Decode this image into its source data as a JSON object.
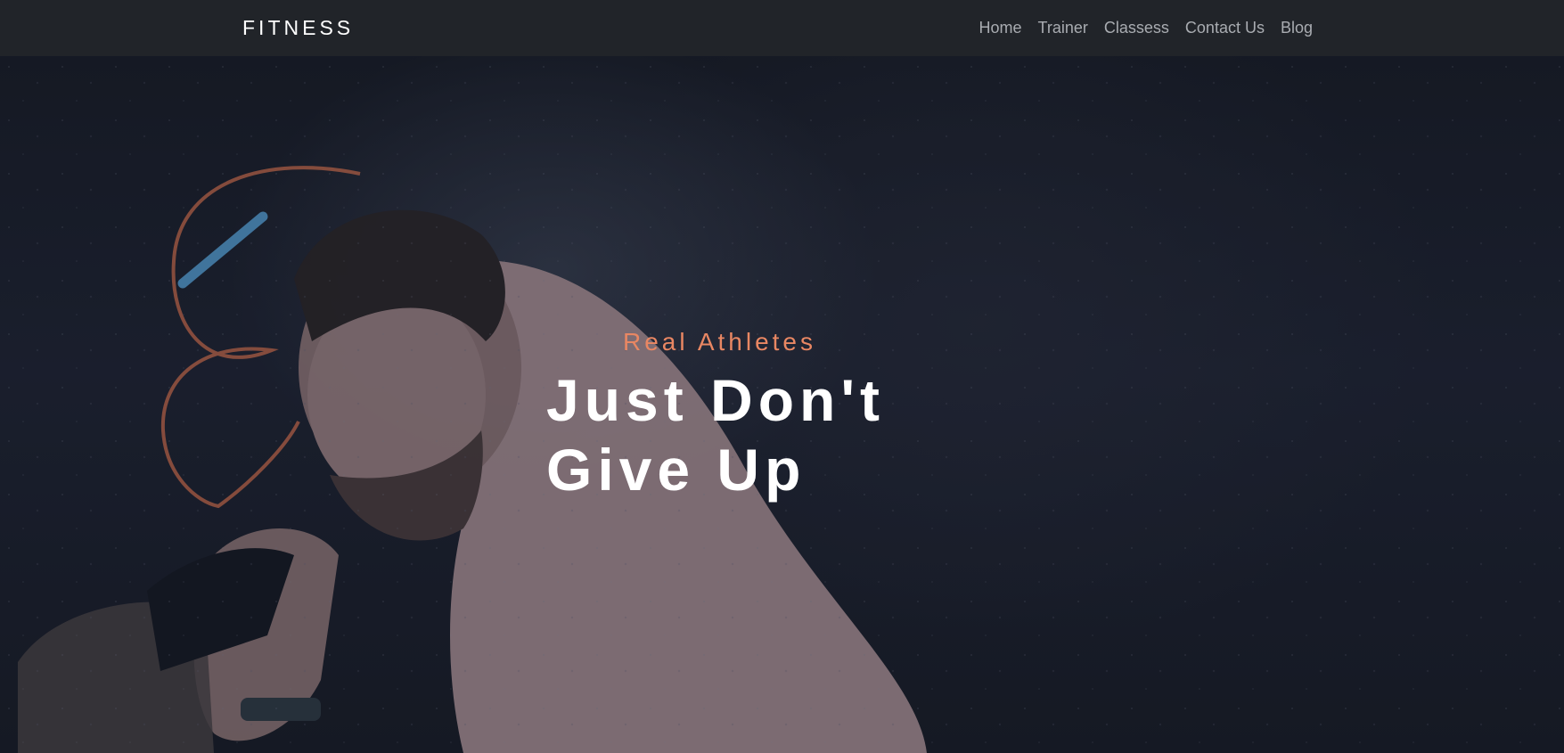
{
  "header": {
    "brand": "FITNESS",
    "nav": [
      {
        "label": "Home"
      },
      {
        "label": "Trainer"
      },
      {
        "label": "Classess"
      },
      {
        "label": "Contact Us"
      },
      {
        "label": "Blog"
      }
    ]
  },
  "hero": {
    "eyebrow": "Real Athletes",
    "headline_line1": "Just Don't",
    "headline_line2": "Give Up",
    "image": "athlete-with-jump-rope",
    "colors": {
      "accent": "#e98763",
      "background": "#1b1f29",
      "navbar": "#212429"
    }
  }
}
